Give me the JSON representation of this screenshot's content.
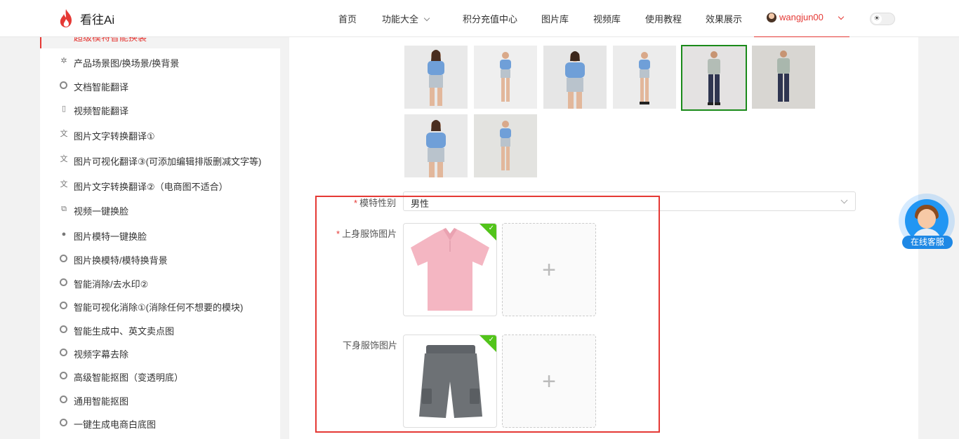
{
  "header": {
    "logo_text": "看往Ai",
    "nav": [
      {
        "label": "首页",
        "has_dropdown": false
      },
      {
        "label": "功能大全",
        "has_dropdown": true
      },
      {
        "label": "积分充值中心",
        "has_dropdown": false
      },
      {
        "label": "图片库",
        "has_dropdown": false
      },
      {
        "label": "视频库",
        "has_dropdown": false
      },
      {
        "label": "使用教程",
        "has_dropdown": false
      },
      {
        "label": "效果展示",
        "has_dropdown": false
      }
    ],
    "username": "wangjun00",
    "accent_color": "#e53935"
  },
  "sidebar": {
    "active_item": "超级模特智能换装",
    "items": [
      {
        "label": "产品场景图/换场景/换背景",
        "icon": "aperture-icon"
      },
      {
        "label": "文档智能翻译",
        "icon": "circle-icon"
      },
      {
        "label": "视频智能翻译",
        "icon": "tablet-icon"
      },
      {
        "label": "图片文字转换翻译①",
        "icon": "translate-icon"
      },
      {
        "label": "图片可视化翻译③(可添加编辑排版删减文字等)",
        "icon": "translate-icon"
      },
      {
        "label": "图片文字转换翻译②（电商图不适合）",
        "icon": "translate-icon"
      },
      {
        "label": "视频一键换脸",
        "icon": "copy-icon"
      },
      {
        "label": "图片模特一键换脸",
        "icon": "person-icon"
      },
      {
        "label": "图片换模特/模特换背景",
        "icon": "circle-icon"
      },
      {
        "label": "智能消除/去水印②",
        "icon": "circle-icon"
      },
      {
        "label": "智能可视化消除①(消除任何不想要的模块)",
        "icon": "circle-icon"
      },
      {
        "label": "智能生成中、英文卖点图",
        "icon": "circle-icon"
      },
      {
        "label": "视频字幕去除",
        "icon": "circle-icon"
      },
      {
        "label": "高级智能抠图（变透明底）",
        "icon": "circle-icon"
      },
      {
        "label": "通用智能抠图",
        "icon": "circle-icon"
      },
      {
        "label": "一键生成电商白底图",
        "icon": "circle-icon"
      }
    ]
  },
  "main": {
    "model_thumbnails": [
      {
        "kind": "female-blue-top",
        "selected": false
      },
      {
        "kind": "female-blue-top",
        "selected": false
      },
      {
        "kind": "female-blue-top",
        "selected": false
      },
      {
        "kind": "female-blue-top",
        "selected": false
      },
      {
        "kind": "male-gray-tee",
        "selected": true
      },
      {
        "kind": "male-gray-tee",
        "selected": false
      },
      {
        "kind": "female-blue-top",
        "selected": false
      },
      {
        "kind": "female-blue-top",
        "selected": false
      }
    ],
    "form": {
      "gender_label": "模特性别",
      "gender_value": "男性",
      "top_label": "上身服饰图片",
      "bottom_label": "下身服饰图片",
      "required_mark": "*",
      "add_symbol": "+"
    }
  },
  "support": {
    "label": "在线客服"
  }
}
